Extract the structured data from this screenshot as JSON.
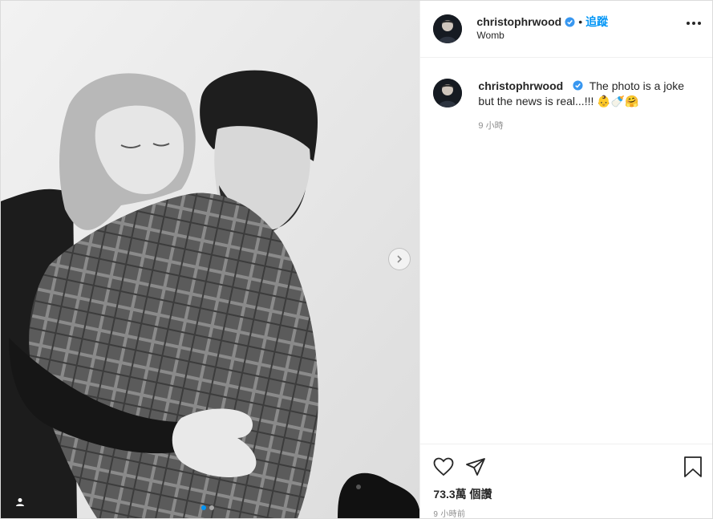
{
  "post": {
    "author": "christophrwood",
    "follow_label": "追蹤",
    "separator": "•",
    "location": "Womb",
    "caption_text": "The photo is a joke but the news is real...!!! 👶🍼🤗",
    "caption_time": "9 小時",
    "likes": "73.3萬 個讚",
    "posted_ago": "9 小時前"
  },
  "carousel": {
    "total": 2,
    "current": 1
  },
  "colors": {
    "accent": "#0095f6",
    "text": "#262626",
    "muted": "#8e8e8e"
  },
  "icons": {
    "verified": "verified-badge-icon",
    "more": "more-options-icon",
    "like": "heart-icon",
    "share": "paper-plane-icon",
    "save": "bookmark-icon",
    "next": "chevron-right-icon",
    "tags": "user-tag-icon"
  }
}
